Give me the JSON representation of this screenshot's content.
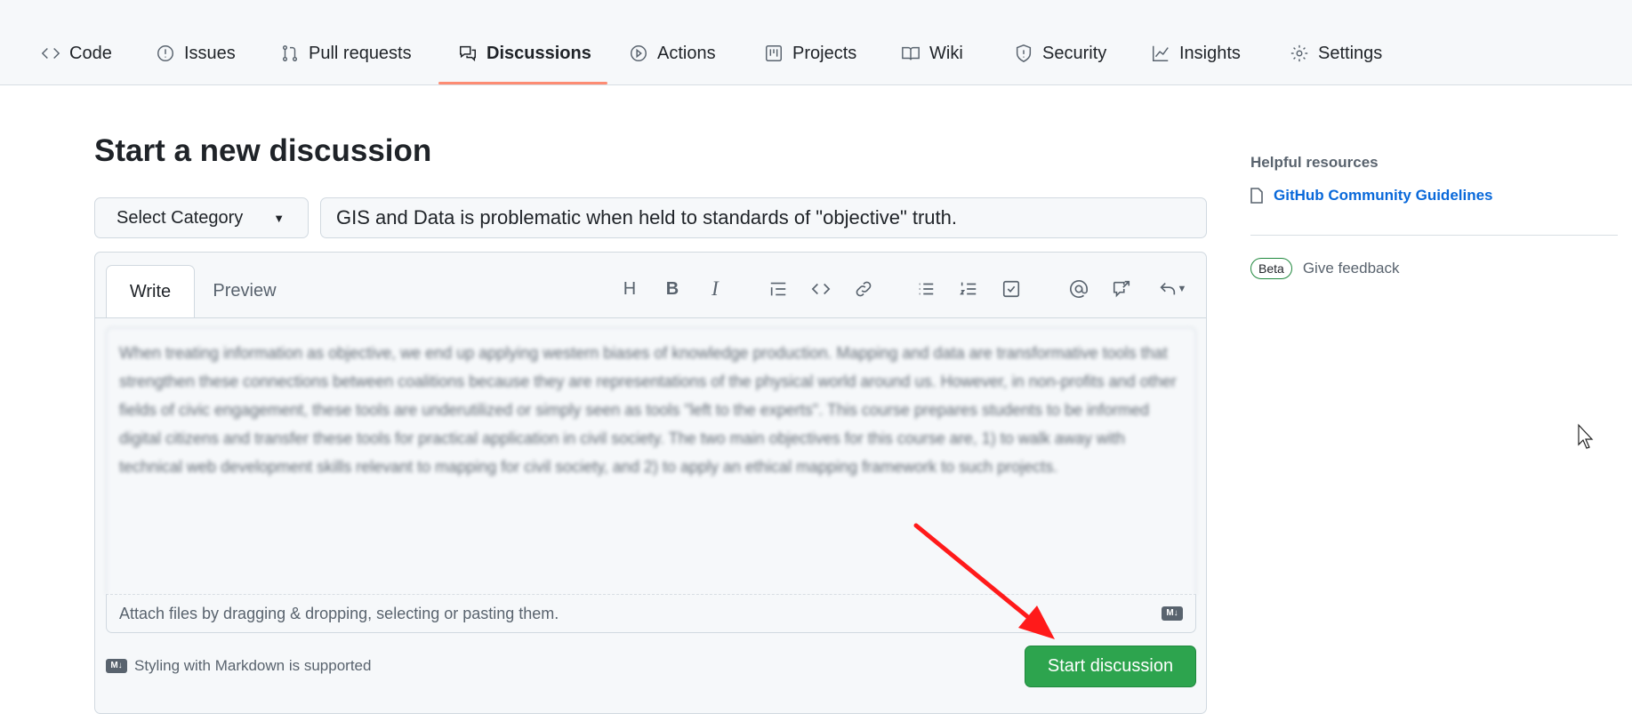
{
  "nav": {
    "tabs": [
      {
        "label": "Code",
        "icon": "code-icon"
      },
      {
        "label": "Issues",
        "icon": "issue-icon"
      },
      {
        "label": "Pull requests",
        "icon": "pull-request-icon"
      },
      {
        "label": "Discussions",
        "icon": "discussion-icon",
        "active": true
      },
      {
        "label": "Actions",
        "icon": "play-icon"
      },
      {
        "label": "Projects",
        "icon": "project-icon"
      },
      {
        "label": "Wiki",
        "icon": "book-icon"
      },
      {
        "label": "Security",
        "icon": "shield-icon"
      },
      {
        "label": "Insights",
        "icon": "graph-icon"
      },
      {
        "label": "Settings",
        "icon": "gear-icon"
      }
    ],
    "accent": "#fd8c73"
  },
  "page": {
    "title": "Start a new discussion"
  },
  "form": {
    "category": "Select Category",
    "title_value": "GIS and Data is problematic when held to standards of \"objective\" truth.",
    "tabs": {
      "write": "Write",
      "preview": "Preview"
    },
    "toolbar": {
      "heading": "H",
      "bold": "B",
      "italic": "I"
    },
    "body": "When treating information as objective, we end up applying western biases of knowledge production. Mapping and data are transformative tools that strengthen these connections between coalitions because they are representations of the physical world around us. However, in non-profits and other fields of civic engagement, these tools are underutilized or simply seen as tools \"left to the experts\". This course prepares students to be informed digital citizens and transfer these tools for practical application in civil society. The two main objectives for this course are, 1) to walk away with technical web development skills relevant to mapping for civil society, and 2) to apply an ethical mapping framework to such projects.",
    "attach_hint": "Attach files by dragging & dropping, selecting or pasting them.",
    "markdown_badge": "M↓",
    "markdown_note": "Styling with Markdown is supported",
    "submit": "Start discussion",
    "submit_color": "#2da44e"
  },
  "sidebar": {
    "heading": "Helpful resources",
    "link": "GitHub Community Guidelines",
    "beta_badge": "Beta",
    "feedback": "Give feedback"
  },
  "annotation": {
    "arrow_color": "#ff0000"
  }
}
